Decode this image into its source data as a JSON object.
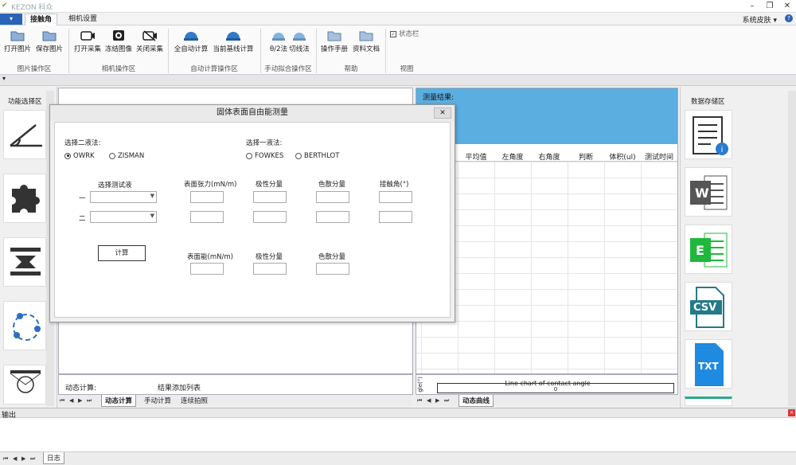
{
  "titlebar": {
    "logo": "✔",
    "title": "KEZON 科众"
  },
  "window_controls": {
    "minimize": "–",
    "restore": "❐",
    "close": "✕"
  },
  "app_menu": "▾",
  "tabs": [
    {
      "label": "接触角"
    },
    {
      "label": "相机设置"
    }
  ],
  "skin_label": "系统皮肤 ▾",
  "help": "?",
  "ribbon": {
    "buttons": [
      {
        "label": "打开图片"
      },
      {
        "label": "保存图片"
      },
      {
        "label": "打开采集"
      },
      {
        "label": "冻结图像"
      },
      {
        "label": "关闭采集"
      },
      {
        "label": "全自动计算"
      },
      {
        "label": "当前基线计算"
      },
      {
        "label": "θ/2法"
      },
      {
        "label": "切线法"
      },
      {
        "label": "操作手册"
      },
      {
        "label": "资料文档"
      }
    ],
    "groups": [
      {
        "label": "图片操作区"
      },
      {
        "label": "相机操作区"
      },
      {
        "label": "自动计算操作区"
      },
      {
        "label": "手动拟合操作区"
      },
      {
        "label": "帮助"
      },
      {
        "label": "视图"
      }
    ],
    "status_bar_checkbox": {
      "label": "状态栏",
      "checked": true,
      "mark": "✓"
    }
  },
  "qat": "▾",
  "left_panel": {
    "title": "功能选择区"
  },
  "right_panel": {
    "title": "数据存储区",
    "file_types": [
      "W",
      "E",
      "CSV",
      "TXT"
    ]
  },
  "results": {
    "title": "测量结果:",
    "columns": [
      "平均值",
      "左角度",
      "右角度",
      "判断",
      "体积(ul)",
      "测试时间"
    ]
  },
  "dialog": {
    "title": "固体表面自由能测量",
    "close": "✕",
    "two_liquid_label": "选择二液法:",
    "two_liquid_options": [
      {
        "label": "OWRK",
        "selected": true
      },
      {
        "label": "ZISMAN",
        "selected": false
      }
    ],
    "one_liquid_label": "选择一液法:",
    "one_liquid_options": [
      {
        "label": "FOWKES",
        "selected": false
      },
      {
        "label": "BERTHLOT",
        "selected": false
      }
    ],
    "col_select": "选择测试液",
    "col_tension": "表面张力(mN/m)",
    "col_polar": "极性分量",
    "col_dispersive": "色散分量",
    "col_angle": "接触角(°)",
    "row1": "一",
    "row2": "二",
    "calc_button": "计算",
    "energy_label": "表面能(mN/m)",
    "energy_polar": "极性分量",
    "energy_dispersive": "色散分量"
  },
  "dynamic": {
    "label": "动态计算:",
    "add_list": "结果添加列表"
  },
  "left_bottom_tabs": [
    {
      "label": "动态计算",
      "active": true
    },
    {
      "label": "手动计算",
      "active": false
    },
    {
      "label": "连续拍照",
      "active": false
    }
  ],
  "chart": {
    "title": "Line chart of contact angle",
    "ylabel": "gle(°)",
    "value": "0"
  },
  "chart_tab": "动态曲线",
  "output": {
    "title": "输出",
    "close": "×",
    "tab": "日志"
  },
  "nav": {
    "first": "⏮",
    "prev": "◀",
    "next": "▶",
    "last": "⏭"
  }
}
